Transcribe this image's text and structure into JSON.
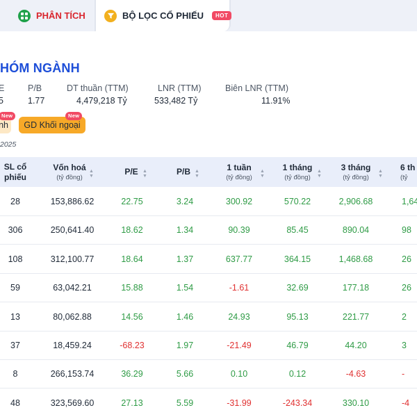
{
  "nav": {
    "analysis_label": "PHÂN TÍCH",
    "filter_label": "BỘ LỌC CỔ PHIẾU",
    "hot_label": "HOT"
  },
  "header": {
    "title": "HÓM NGÀNH",
    "summary": [
      {
        "label": "E",
        "value": "5"
      },
      {
        "label": "P/B",
        "value": "1.77"
      },
      {
        "label": "DT thuần (TTM)",
        "value": "4,479,218 Tỷ"
      },
      {
        "label": "LNR (TTM)",
        "value": "533,482 Tỷ"
      },
      {
        "label": "Biên LNR (TTM)",
        "value": "11.91%"
      }
    ],
    "pill_left_label": "nh",
    "pill_fx_label": "GD Khối ngoại",
    "new_label": "New",
    "date_text": "2025"
  },
  "table": {
    "headers": [
      {
        "l1": "SL cổ",
        "l2": "phiếu"
      },
      {
        "l1": "Vốn hoá",
        "l2": "(tỷ đồng)"
      },
      {
        "l1": "P/E",
        "l2": ""
      },
      {
        "l1": "P/B",
        "l2": ""
      },
      {
        "l1": "1 tuần",
        "l2": "(tỷ đồng)"
      },
      {
        "l1": "1 tháng",
        "l2": "(tỷ đồng)"
      },
      {
        "l1": "3 tháng",
        "l2": "(tỷ đồng)"
      },
      {
        "l1": "6 th",
        "l2": "(tỷ"
      }
    ],
    "sort_icon": "sort-icon",
    "rows": [
      {
        "count": "28",
        "cap": "153,886.62",
        "pe": "22.75",
        "pb": "3.24",
        "w1": "300.92",
        "m1": "570.22",
        "m3": "2,906.68",
        "m6": "1,64"
      },
      {
        "count": "306",
        "cap": "250,641.40",
        "pe": "18.62",
        "pb": "1.34",
        "w1": "90.39",
        "m1": "85.45",
        "m3": "890.04",
        "m6": "98"
      },
      {
        "count": "108",
        "cap": "312,100.77",
        "pe": "18.64",
        "pb": "1.37",
        "w1": "637.77",
        "m1": "364.15",
        "m3": "1,468.68",
        "m6": "26"
      },
      {
        "count": "59",
        "cap": "63,042.21",
        "pe": "15.88",
        "pb": "1.54",
        "w1": "-1.61",
        "m1": "32.69",
        "m3": "177.18",
        "m6": "26"
      },
      {
        "count": "13",
        "cap": "80,062.88",
        "pe": "14.56",
        "pb": "1.46",
        "w1": "24.93",
        "m1": "95.13",
        "m3": "221.77",
        "m6": "2"
      },
      {
        "count": "37",
        "cap": "18,459.24",
        "pe": "-68.23",
        "pb": "1.97",
        "w1": "-21.49",
        "m1": "46.79",
        "m3": "44.20",
        "m6": "3"
      },
      {
        "count": "8",
        "cap": "266,153.74",
        "pe": "36.29",
        "pb": "5.66",
        "w1": "0.10",
        "m1": "0.12",
        "m3": "-4.63",
        "m6": "-"
      },
      {
        "count": "48",
        "cap": "323,569.60",
        "pe": "27.13",
        "pb": "5.59",
        "w1": "-31.99",
        "m1": "-243.34",
        "m3": "330.10",
        "m6": "-4"
      }
    ]
  },
  "colors": {
    "accent_blue": "#1d4ed8",
    "positive": "#2e9b45",
    "negative": "#e03131",
    "header_bg": "#e9eefa",
    "hot_badge": "#f14a64",
    "fx_pill": "#f7a928"
  }
}
